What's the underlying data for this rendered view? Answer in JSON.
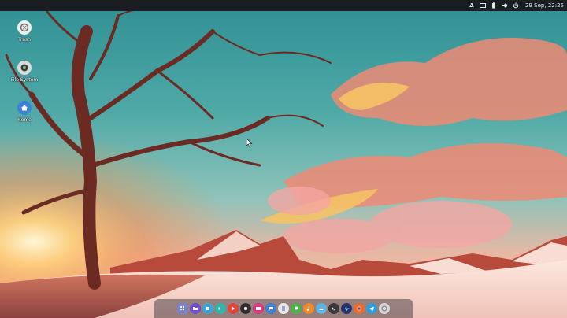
{
  "desktop": {
    "icons": [
      {
        "label": "Trash",
        "icon": "trash-icon"
      },
      {
        "label": "File System",
        "icon": "drive-icon"
      },
      {
        "label": "Home",
        "icon": "home-folder-icon"
      }
    ]
  },
  "topbar": {
    "clock": "29 Sep, 22:25",
    "tray": [
      "notifications-muted-icon",
      "window-icon",
      "battery-icon",
      "volume-icon",
      "power-icon"
    ]
  },
  "dock": {
    "items": [
      {
        "icon": "app-launcher-icon",
        "color": "#7c83c8"
      },
      {
        "icon": "file-manager-icon",
        "color": "#6b4fcf"
      },
      {
        "icon": "software-store-icon",
        "color": "#3ba7d6"
      },
      {
        "icon": "terminal-icon",
        "color": "#2fb8a8"
      },
      {
        "icon": "media-player-icon",
        "color": "#e0443c"
      },
      {
        "icon": "screenshot-icon",
        "color": "#333333"
      },
      {
        "icon": "mail-icon",
        "color": "#d9357a"
      },
      {
        "icon": "chat-icon",
        "color": "#3f7fd8"
      },
      {
        "icon": "document-icon",
        "color": "#e9e9e9"
      },
      {
        "icon": "maps-icon",
        "color": "#4caf50"
      },
      {
        "icon": "music-icon",
        "color": "#f08a2a"
      },
      {
        "icon": "photos-icon",
        "color": "#5cb3e0"
      },
      {
        "icon": "console-icon",
        "color": "#3a3a3a"
      },
      {
        "icon": "system-monitor-icon",
        "color": "#28306a"
      },
      {
        "icon": "firefox-icon",
        "color": "#ef6a2b"
      },
      {
        "icon": "telegram-icon",
        "color": "#2a9fd8"
      },
      {
        "icon": "trash-dock-icon",
        "color": "#d8d8d8"
      }
    ]
  }
}
